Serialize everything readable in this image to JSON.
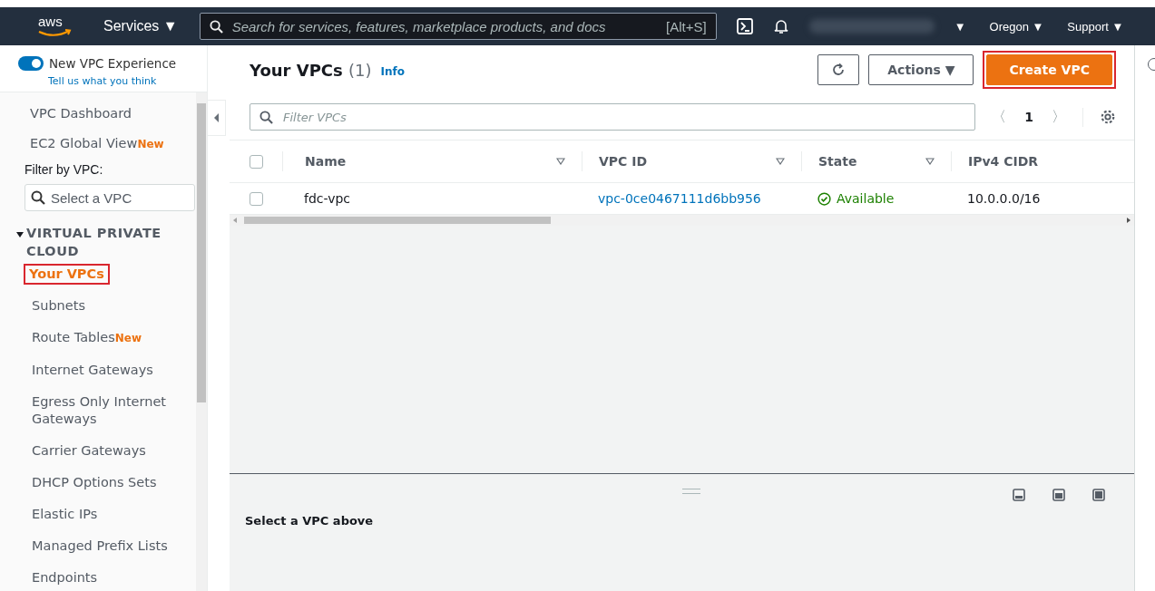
{
  "topnav": {
    "logo": "aws",
    "services": "Services ▼",
    "search_placeholder": "Search for services, features, marketplace products, and docs",
    "shortcut": "[Alt+S]",
    "account_caret": "▼",
    "region": "Oregon ▼",
    "support": "Support ▼"
  },
  "sidebar": {
    "toggle": {
      "label": "New VPC Experience",
      "on": true
    },
    "feedback_link": "Tell us what you think",
    "top_items": [
      {
        "label": "VPC Dashboard"
      },
      {
        "label": "EC2 Global View",
        "badge": "New"
      }
    ],
    "filter_label": "Filter by VPC:",
    "filter_placeholder": "Select a VPC",
    "section": {
      "title": "VIRTUAL PRIVATE CLOUD",
      "expanded": true,
      "items": [
        {
          "label": "Your VPCs",
          "selected": true,
          "highlighted": true
        },
        {
          "label": "Subnets",
          "selected": false,
          "highlighted": false
        },
        {
          "label": "Route Tables",
          "badge": "New",
          "selected": false,
          "highlighted": false
        },
        {
          "label": "Internet Gateways",
          "selected": false,
          "highlighted": false
        },
        {
          "label": "Egress Only Internet Gateways",
          "selected": false,
          "highlighted": false
        },
        {
          "label": "Carrier Gateways",
          "selected": false,
          "highlighted": false
        },
        {
          "label": "DHCP Options Sets",
          "selected": false,
          "highlighted": false
        },
        {
          "label": "Elastic IPs",
          "selected": false,
          "highlighted": false
        },
        {
          "label": "Managed Prefix Lists",
          "selected": false,
          "highlighted": false
        },
        {
          "label": "Endpoints",
          "selected": false,
          "highlighted": false
        }
      ]
    }
  },
  "main": {
    "title": "Your VPCs",
    "count": "(1)",
    "info": "Info",
    "actions": "Actions ▼",
    "create": {
      "label": "Create VPC",
      "highlighted": true
    },
    "filter_placeholder": "Filter VPCs",
    "page": "1",
    "page_prev": "〈",
    "page_next": "〉",
    "table": {
      "select_all": {
        "checked": false
      },
      "columns": [
        {
          "label": "Name",
          "sortable": true
        },
        {
          "label": "VPC ID",
          "sortable": true
        },
        {
          "label": "State",
          "sortable": true
        },
        {
          "label": "IPv4 CIDR",
          "sortable": false
        }
      ],
      "rows": [
        {
          "selected": false,
          "name": "fdc-vpc",
          "vpc_id": "vpc-0ce0467111d6bb956",
          "state": "Available",
          "cidr": "10.0.0.0/16"
        }
      ]
    }
  },
  "detail": {
    "message": "Select a VPC above"
  }
}
